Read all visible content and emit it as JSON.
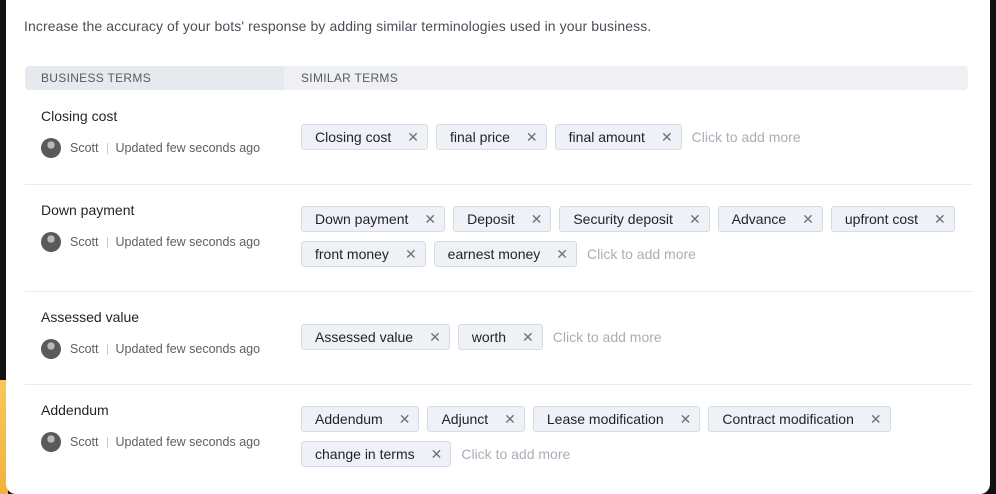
{
  "intro_text": "Increase the accuracy of your bots' response by adding similar terminologies used in your business.",
  "table": {
    "col_business": "BUSINESS TERMS",
    "col_similar": "SIMILAR TERMS"
  },
  "add_more_label": "Click to add more",
  "rows": [
    {
      "name": "Closing cost",
      "user": "Scott",
      "updated": "Updated few seconds ago",
      "terms": [
        "Closing cost",
        "final price",
        "final amount"
      ]
    },
    {
      "name": "Down payment",
      "user": "Scott",
      "updated": "Updated few seconds ago",
      "terms": [
        "Down payment",
        "Deposit",
        "Security deposit",
        "Advance",
        "upfront cost",
        "front money",
        "earnest money"
      ]
    },
    {
      "name": "Assessed value",
      "user": "Scott",
      "updated": "Updated few seconds ago",
      "terms": [
        "Assessed value",
        "worth"
      ]
    },
    {
      "name": "Addendum",
      "user": "Scott",
      "updated": "Updated few seconds ago",
      "terms": [
        "Addendum",
        "Adjunct",
        "Lease modification",
        "Contract modification",
        "change in terms"
      ]
    }
  ],
  "icons": {
    "remove": "close-icon",
    "avatar": "user-avatar"
  },
  "colors": {
    "chip_bg": "#eef1f6",
    "chip_border": "#d7dce4",
    "header_bg": "#eef0f3",
    "placeholder": "#a9aeb6"
  }
}
